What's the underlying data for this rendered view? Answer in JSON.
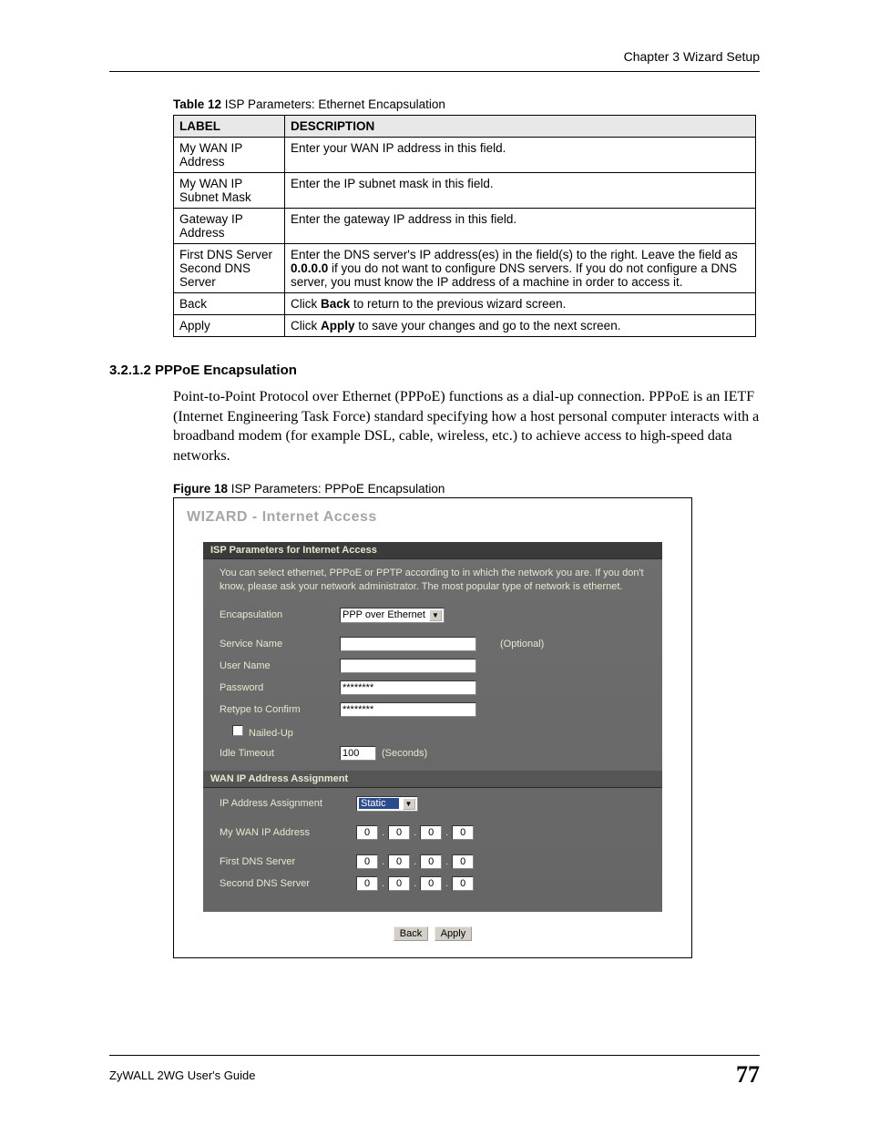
{
  "chapter_header": "Chapter 3 Wizard Setup",
  "table_caption_bold": "Table 12",
  "table_caption_rest": "   ISP Parameters: Ethernet Encapsulation",
  "table": {
    "headers": [
      "LABEL",
      "DESCRIPTION"
    ],
    "rows": [
      {
        "label": "My WAN IP Address",
        "desc": "Enter your WAN IP address in this field."
      },
      {
        "label": "My WAN IP Subnet Mask",
        "desc": "Enter the IP subnet mask in this field."
      },
      {
        "label": "Gateway IP Address",
        "desc": "Enter the gateway IP address in this field."
      },
      {
        "label": "First DNS Server Second DNS Server",
        "desc_pre": "Enter the DNS server's IP address(es) in the field(s) to the right.\nLeave the field as ",
        "desc_bold": "0.0.0.0",
        "desc_post": " if you do not want to configure DNS servers. If you do not configure a DNS server, you must know the IP address of a machine in order to access it."
      },
      {
        "label": "Back",
        "desc_pre": "Click ",
        "desc_bold": "Back",
        "desc_post": " to return to the previous wizard screen."
      },
      {
        "label": "Apply",
        "desc_pre": "Click ",
        "desc_bold": "Apply",
        "desc_post": " to save your changes and go to the next screen."
      }
    ]
  },
  "section_heading": "3.2.1.2  PPPoE Encapsulation",
  "body_text": " Point-to-Point Protocol over Ethernet (PPPoE) functions as a dial-up connection. PPPoE is an IETF (Internet Engineering Task Force) standard specifying how a host personal computer interacts with a broadband modem (for example DSL, cable, wireless, etc.) to achieve access to high-speed data networks.",
  "figure_caption_bold": "Figure 18",
  "figure_caption_rest": "   ISP Parameters: PPPoE Encapsulation",
  "wizard": {
    "title": "WIZARD - Internet Access",
    "panel1_header": "ISP Parameters for Internet Access",
    "intro": "You can select ethernet, PPPoE or PPTP according to in which the network you are. If you don't know, please ask your network administrator. The most popular type of network is ethernet.",
    "labels": {
      "encapsulation": "Encapsulation",
      "service_name": "Service Name",
      "user_name": "User Name",
      "password": "Password",
      "retype": "Retype to Confirm",
      "nailed_up": "Nailed-Up",
      "idle_timeout": "Idle Timeout",
      "seconds": "(Seconds)",
      "optional": "(Optional)"
    },
    "values": {
      "encapsulation": "PPP over Ethernet",
      "password": "********",
      "retype": "********",
      "idle_timeout": "100"
    },
    "panel2_header": "WAN IP Address Assignment",
    "labels2": {
      "ip_assignment": "IP Address Assignment",
      "my_wan_ip": "My WAN IP Address",
      "first_dns": "First DNS Server",
      "second_dns": "Second DNS Server"
    },
    "values2": {
      "ip_assignment": "Static",
      "my_wan_ip": [
        "0",
        "0",
        "0",
        "0"
      ],
      "first_dns": [
        "0",
        "0",
        "0",
        "0"
      ],
      "second_dns": [
        "0",
        "0",
        "0",
        "0"
      ]
    },
    "buttons": {
      "back": "Back",
      "apply": "Apply"
    }
  },
  "footer_left": "ZyWALL 2WG User's Guide",
  "footer_right": "77"
}
